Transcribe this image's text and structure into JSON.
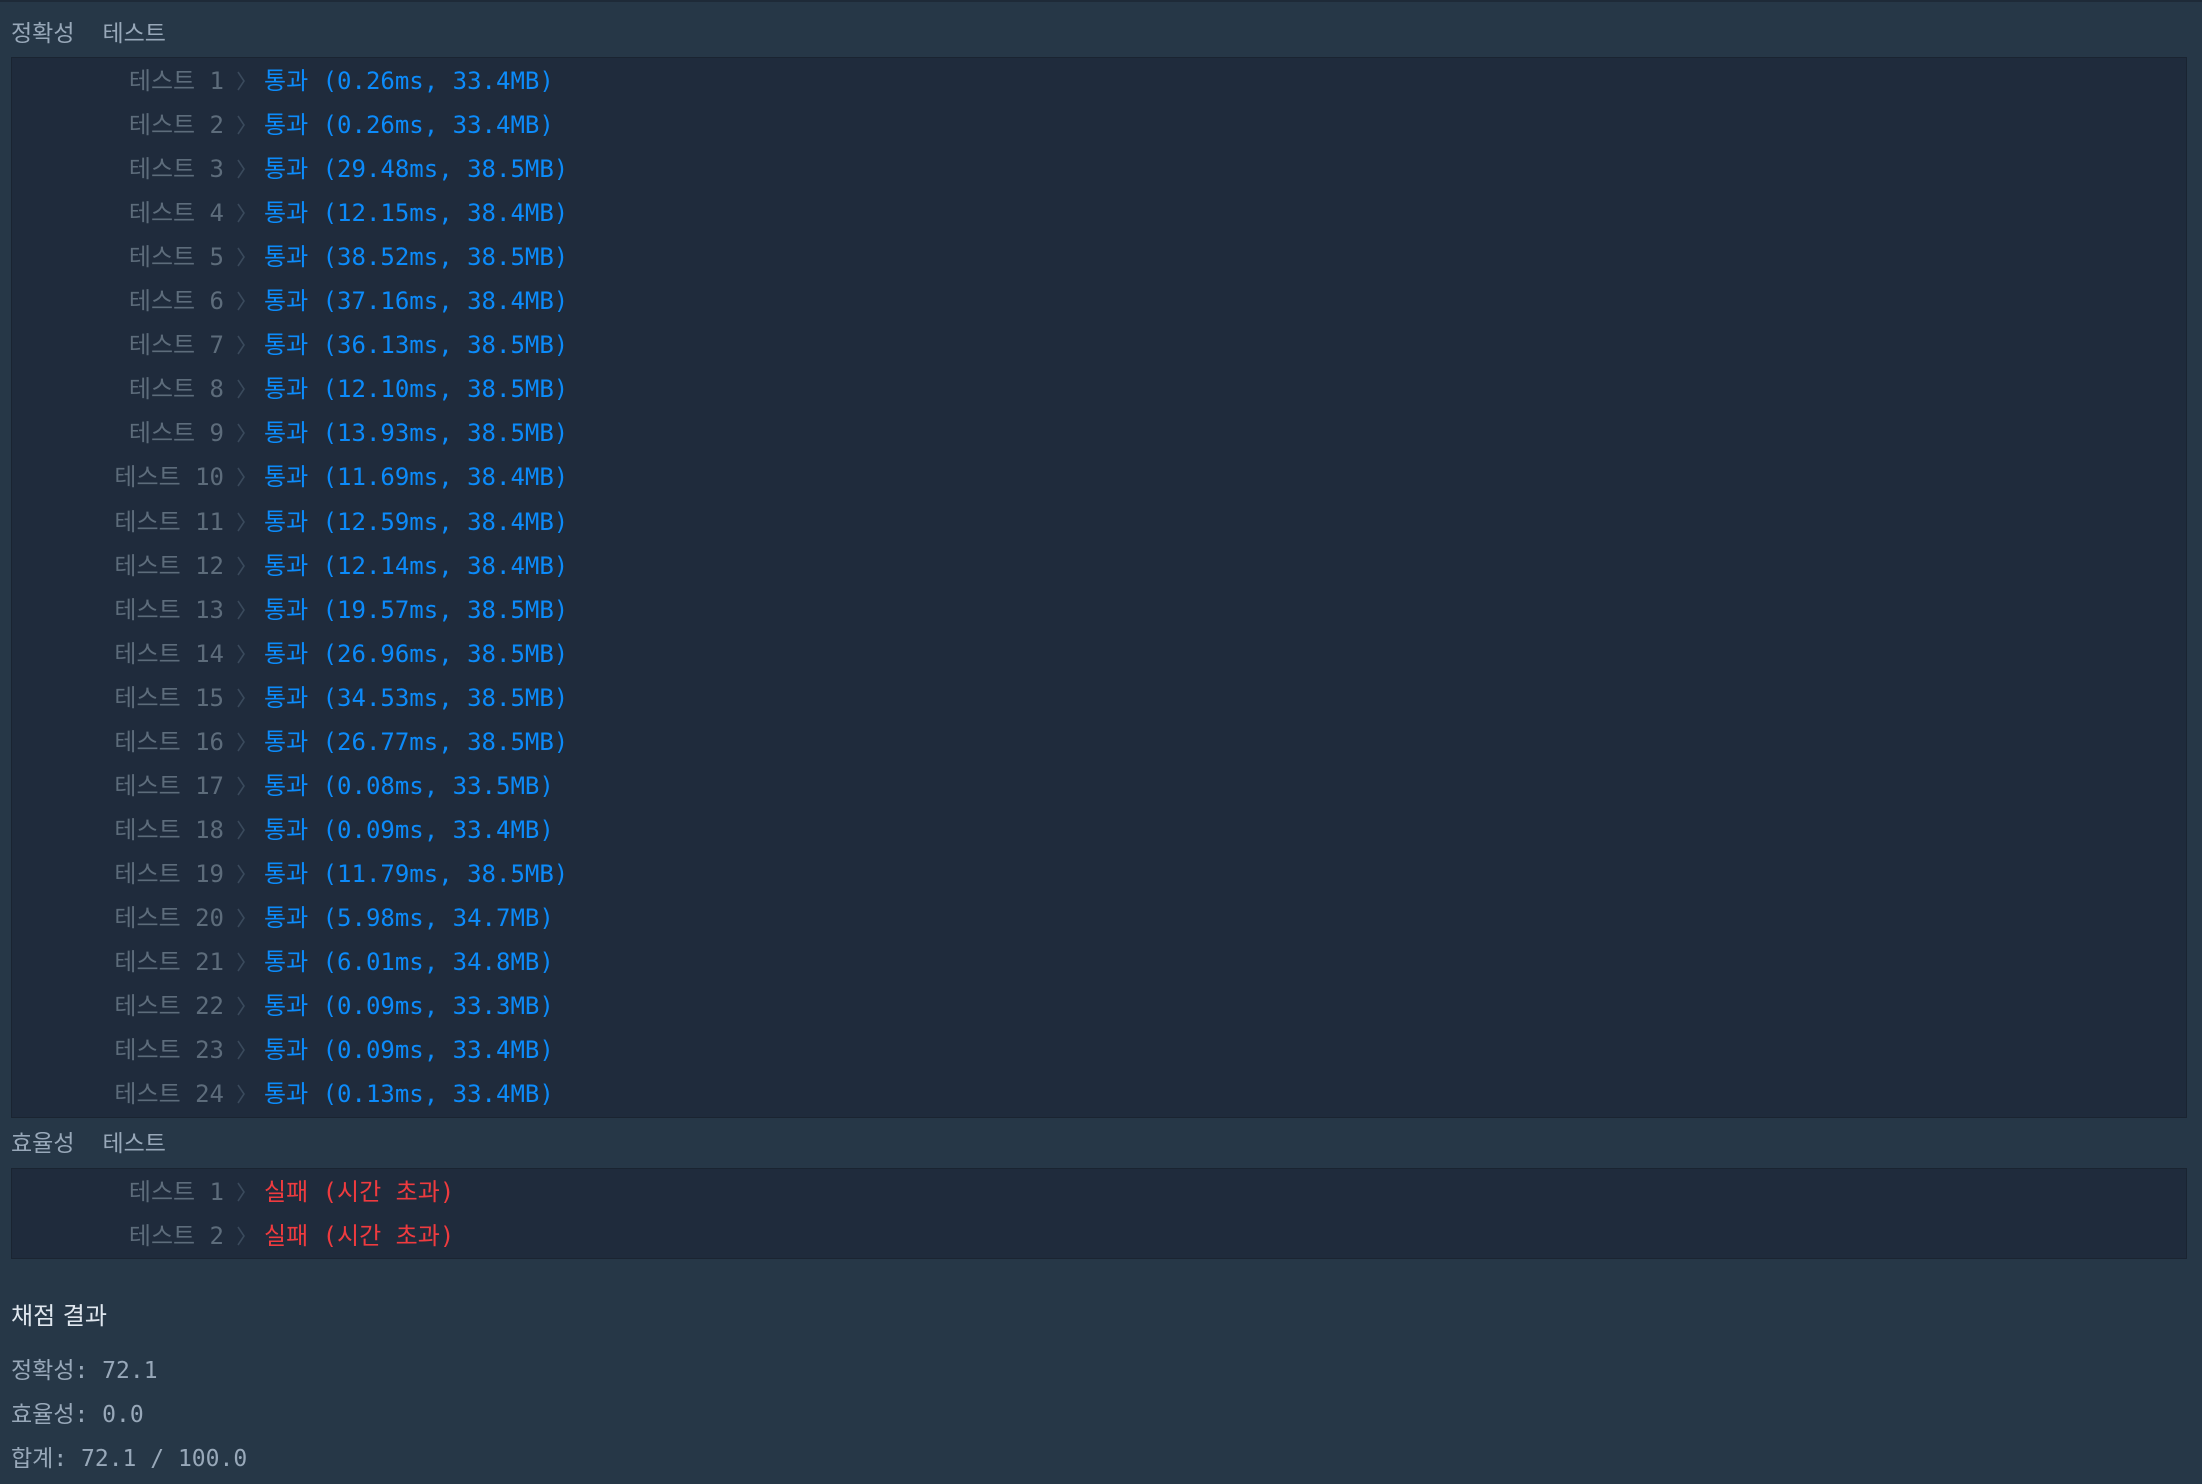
{
  "accuracy": {
    "header_word1": "정확성",
    "header_word2": "테스트",
    "tests": [
      {
        "label": "테스트 1",
        "result": "통과 (0.26ms, 33.4MB)",
        "status": "pass"
      },
      {
        "label": "테스트 2",
        "result": "통과 (0.26ms, 33.4MB)",
        "status": "pass"
      },
      {
        "label": "테스트 3",
        "result": "통과 (29.48ms, 38.5MB)",
        "status": "pass"
      },
      {
        "label": "테스트 4",
        "result": "통과 (12.15ms, 38.4MB)",
        "status": "pass"
      },
      {
        "label": "테스트 5",
        "result": "통과 (38.52ms, 38.5MB)",
        "status": "pass"
      },
      {
        "label": "테스트 6",
        "result": "통과 (37.16ms, 38.4MB)",
        "status": "pass"
      },
      {
        "label": "테스트 7",
        "result": "통과 (36.13ms, 38.5MB)",
        "status": "pass"
      },
      {
        "label": "테스트 8",
        "result": "통과 (12.10ms, 38.5MB)",
        "status": "pass"
      },
      {
        "label": "테스트 9",
        "result": "통과 (13.93ms, 38.5MB)",
        "status": "pass"
      },
      {
        "label": "테스트 10",
        "result": "통과 (11.69ms, 38.4MB)",
        "status": "pass"
      },
      {
        "label": "테스트 11",
        "result": "통과 (12.59ms, 38.4MB)",
        "status": "pass"
      },
      {
        "label": "테스트 12",
        "result": "통과 (12.14ms, 38.4MB)",
        "status": "pass"
      },
      {
        "label": "테스트 13",
        "result": "통과 (19.57ms, 38.5MB)",
        "status": "pass"
      },
      {
        "label": "테스트 14",
        "result": "통과 (26.96ms, 38.5MB)",
        "status": "pass"
      },
      {
        "label": "테스트 15",
        "result": "통과 (34.53ms, 38.5MB)",
        "status": "pass"
      },
      {
        "label": "테스트 16",
        "result": "통과 (26.77ms, 38.5MB)",
        "status": "pass"
      },
      {
        "label": "테스트 17",
        "result": "통과 (0.08ms, 33.5MB)",
        "status": "pass"
      },
      {
        "label": "테스트 18",
        "result": "통과 (0.09ms, 33.4MB)",
        "status": "pass"
      },
      {
        "label": "테스트 19",
        "result": "통과 (11.79ms, 38.5MB)",
        "status": "pass"
      },
      {
        "label": "테스트 20",
        "result": "통과 (5.98ms, 34.7MB)",
        "status": "pass"
      },
      {
        "label": "테스트 21",
        "result": "통과 (6.01ms, 34.8MB)",
        "status": "pass"
      },
      {
        "label": "테스트 22",
        "result": "통과 (0.09ms, 33.3MB)",
        "status": "pass"
      },
      {
        "label": "테스트 23",
        "result": "통과 (0.09ms, 33.4MB)",
        "status": "pass"
      },
      {
        "label": "테스트 24",
        "result": "통과 (0.13ms, 33.4MB)",
        "status": "pass"
      }
    ]
  },
  "efficiency": {
    "header_word1": "효율성",
    "header_word2": "테스트",
    "tests": [
      {
        "label": "테스트 1",
        "result": "실패 (시간 초과)",
        "status": "fail"
      },
      {
        "label": "테스트 2",
        "result": "실패 (시간 초과)",
        "status": "fail"
      }
    ]
  },
  "summary": {
    "title": "채점 결과",
    "accuracy_line": "정확성: 72.1",
    "efficiency_line": "효율성: 0.0",
    "total_line": "합계: 72.1 / 100.0"
  },
  "colors": {
    "pass": "#0c8bfa",
    "fail": "#ef3b3f",
    "label": "#5d6c7b",
    "background": "#263747",
    "panel": "#1f2b3c"
  },
  "icons": {
    "row_separator": "chevron-right-icon"
  }
}
